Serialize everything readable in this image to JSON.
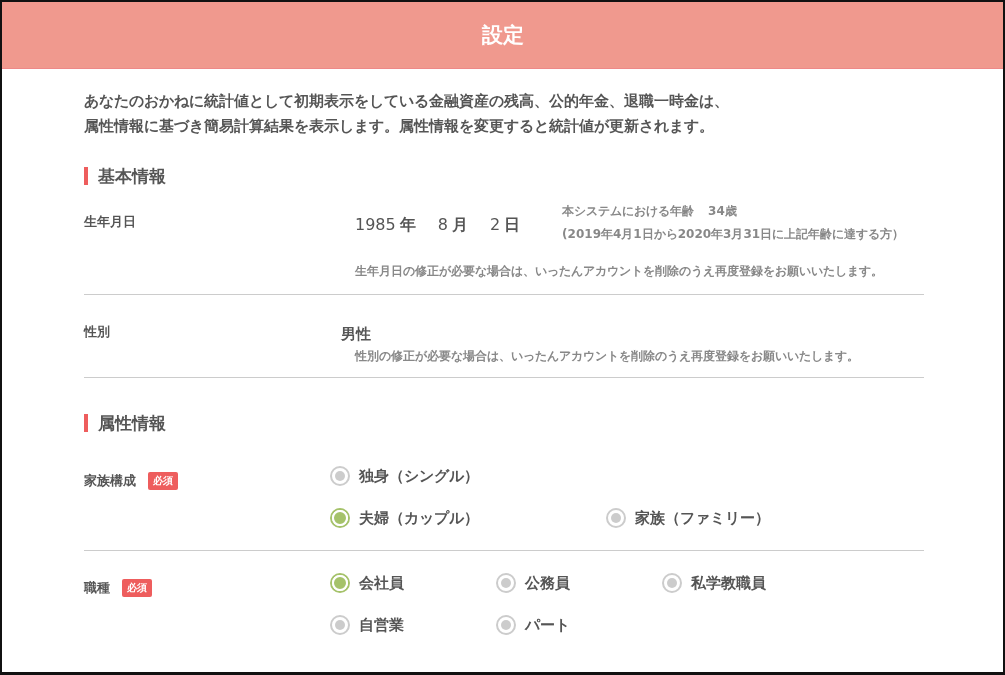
{
  "header": {
    "title": "設定"
  },
  "intro": [
    "あなたのおかねに統計値として初期表示をしている金融資産の残高、公的年金、退職一時金は、",
    "属性情報に基づき簡易計算結果を表示します。属性情報を変更すると統計値が更新されます。"
  ],
  "basic": {
    "heading": "基本情報",
    "birthdate": {
      "label": "生年月日",
      "year": "1985",
      "year_unit": "年",
      "month": "8",
      "month_unit": "月",
      "day": "2",
      "day_unit": "日",
      "age_label": "本システムにおける年齢",
      "age": "34歳",
      "age_note": "(2019年4月1日から2020年3月31日に上記年齢に達する方）",
      "note": "生年月日の修正が必要な場合は、いったんアカウントを削除のうえ再度登録をお願いいたします。"
    },
    "gender": {
      "label": "性別",
      "value": "男性",
      "note": "性別の修正が必要な場合は、いったんアカウントを削除のうえ再度登録をお願いいたします。"
    }
  },
  "attributes": {
    "heading": "属性情報",
    "groups": [
      {
        "label": "家族構成",
        "badge": "必須",
        "rows": [
          [
            {
              "label": "独身（シングル）",
              "selected": false
            }
          ],
          [
            {
              "label": "夫婦（カップル）",
              "selected": true
            },
            {
              "label": "家族（ファミリー）",
              "selected": false
            }
          ]
        ]
      },
      {
        "label": "職種",
        "badge": "必須",
        "rows": [
          [
            {
              "label": "会社員",
              "selected": true
            },
            {
              "label": "公務員",
              "selected": false
            },
            {
              "label": "私学教職員",
              "selected": false
            }
          ],
          [
            {
              "label": "自営業",
              "selected": false
            },
            {
              "label": "パート",
              "selected": false
            }
          ]
        ]
      }
    ]
  }
}
